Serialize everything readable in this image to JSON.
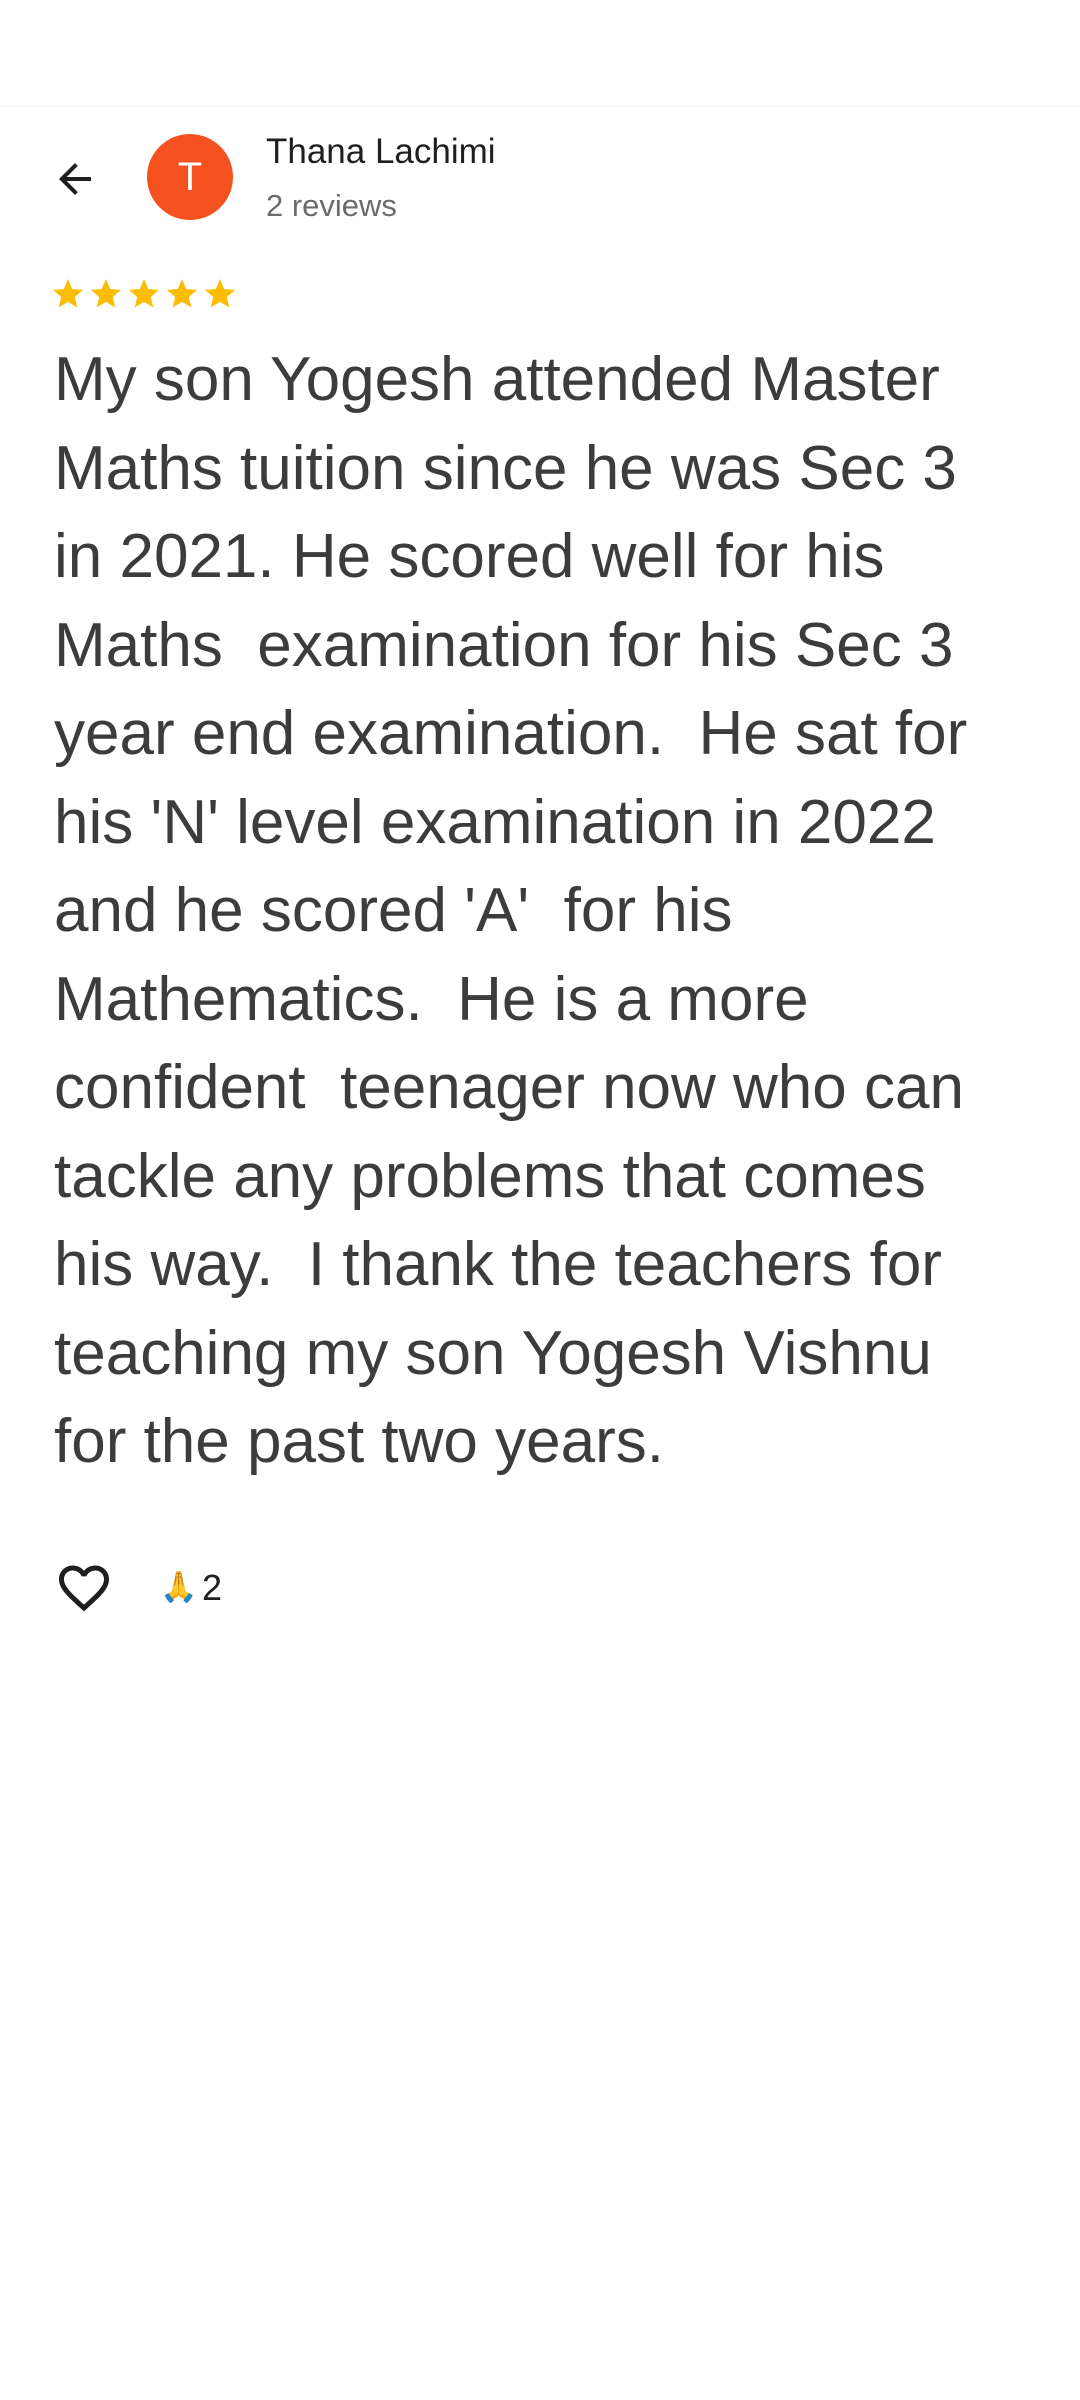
{
  "header": {
    "back_icon": "arrow-left-icon",
    "reviewer": {
      "avatar_initial": "T",
      "avatar_color": "#f4511e",
      "name": "Thana Lachimi",
      "meta": "2 reviews"
    }
  },
  "review": {
    "rating": 5,
    "rating_max": 5,
    "star_color": "#fbbc04",
    "star_icon": "star-icon",
    "text": "My son Yogesh attended Master\nMaths tuition since he was Sec 3\nin 2021. He scored well for his\nMaths  examination for his Sec 3\nyear end examination.  He sat for\nhis 'N' level examination in 2022\nand he scored 'A'  for his\nMathematics.  He is a more\nconfident  teenager now who can\ntackle any problems that comes\nhis way.  I thank the teachers for\nteaching my son Yogesh Vishnu\nfor the past two years."
  },
  "actions": {
    "like_icon": "heart-outline-icon",
    "reaction": {
      "emoji": "🙏",
      "count": "2"
    }
  }
}
